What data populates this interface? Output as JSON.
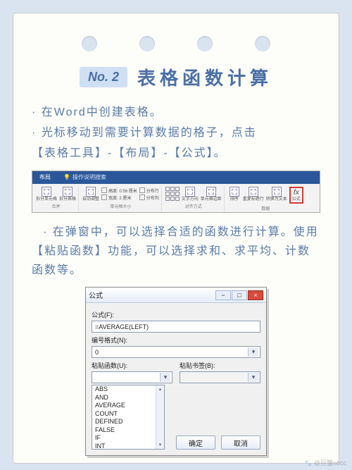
{
  "header": {
    "badge": "No. 2",
    "title": "表格函数计算"
  },
  "intro": {
    "line1": "· 在Word中创建表格。",
    "line2": "· 光标移动到需要计算数据的格子，点击",
    "line3": "【表格工具】-【布局】-【公式】。"
  },
  "ribbon": {
    "tab_active": "布局",
    "search": "操作说明搜索",
    "g1": {
      "a": "拆分单元格",
      "b": "拆分表格",
      "label": "合并"
    },
    "g2": {
      "auto": "自动调整",
      "h": "高度: 0.56 厘米",
      "w": "宽度: 2 厘米",
      "dr": "分布行",
      "dc": "分布列",
      "label": "单元格大小"
    },
    "g3": {
      "a": "文字方向",
      "b": "单元格边距",
      "label": "对齐方式"
    },
    "g4": {
      "a": "排序",
      "b": "重复标题行",
      "c": "转换为文本",
      "fx": "公式",
      "fxicon": "fx",
      "label": "数据"
    }
  },
  "para2": "· 在弹窗中，可以选择合适的函数进行计算。使用【粘贴函数】功能，可以选择求和、求平均、计数函数等。",
  "dialog": {
    "title": "公式",
    "min": "−",
    "max": "□",
    "close": "×",
    "formula_label": "公式(F):",
    "formula_value": "=AVERAGE(LEFT)",
    "format_label": "编号格式(N):",
    "format_value": "0",
    "paste_fn_label": "粘贴函数(U):",
    "paste_bm_label": "粘贴书签(B):",
    "functions": [
      "ABS",
      "AND",
      "AVERAGE",
      "COUNT",
      "DEFINED",
      "FALSE",
      "IF",
      "INT"
    ],
    "ok": "确定",
    "cancel": "取消"
  },
  "watermark": "🐾 @巨蟹nbcc"
}
